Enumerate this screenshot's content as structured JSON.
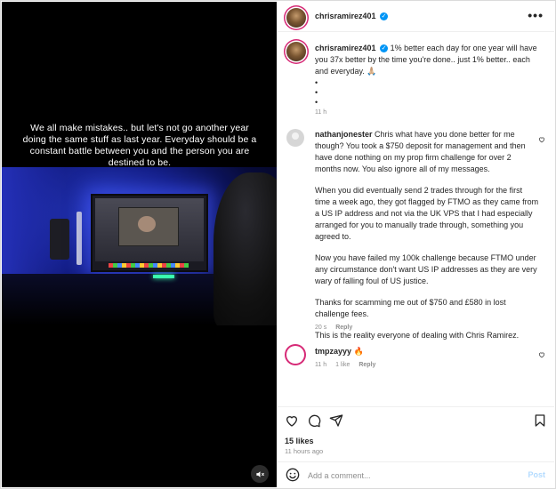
{
  "media": {
    "caption": "We all make mistakes.. but let's not go another year doing the same stuff as last year. Everyday should be a constant battle between you and the person you are destined to be.",
    "mute_icon": "speaker-muted-icon"
  },
  "header": {
    "username": "chrisramirez401",
    "verified_icon": "verified-badge-icon",
    "more_icon": "more-options-icon",
    "more_label": "•••"
  },
  "caption": {
    "username": "chrisramirez401",
    "text": "1% better each day for one year will have you 37x better by the time you're done.. just 1% better.. each and everyday. 🙏🏼",
    "bullets": [
      "•",
      "•",
      "•"
    ],
    "time": "11 h"
  },
  "comments": [
    {
      "username": "nathanjonester",
      "paragraphs": [
        "Chris what have you done better for me though? You took a $750 deposit for management and then have done nothing on my prop firm challenge for over 2 months now. You also ignore all of my messages.",
        "When you did eventually send 2 trades through for the first time a week ago, they got flagged by FTMO as they came from a US IP address and not via the UK VPS that I had especially arranged for you to manually trade through, something you agreed to.",
        "Now you have failed my 100k challenge because FTMO under any circumstance don't want US IP addresses as they are very wary of falling foul of US justice.",
        "Thanks for scamming me out of $750 and £580 in lost challenge fees.",
        "This is the reality everyone of dealing with Chris Ramirez."
      ],
      "time": "20 s",
      "reply": "Reply"
    },
    {
      "username": "tmpzayyy",
      "text": "🔥",
      "time": "11 h",
      "likes": "1 like",
      "reply": "Reply"
    }
  ],
  "actions": {
    "like_icon": "heart-icon",
    "comment_icon": "comment-icon",
    "share_icon": "share-icon",
    "save_icon": "bookmark-icon",
    "likes": "15 likes",
    "ago": "11 hours ago"
  },
  "add_comment": {
    "emoji_icon": "emoji-icon",
    "placeholder": "Add a comment...",
    "post_label": "Post"
  }
}
